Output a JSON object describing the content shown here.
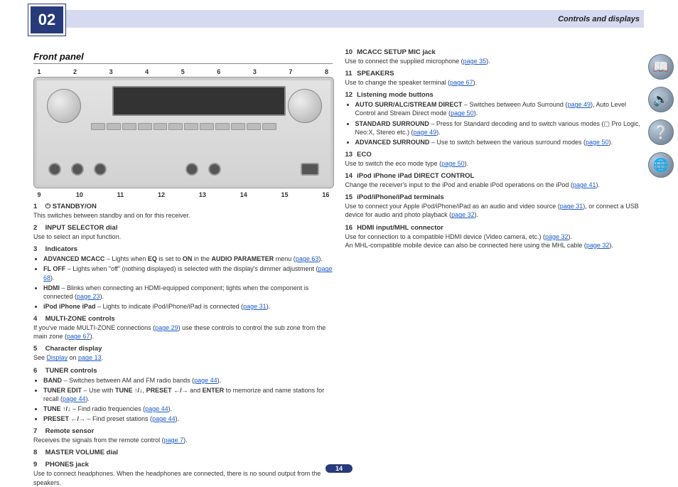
{
  "chapter_number": "02",
  "chapter_title": "Controls and displays",
  "section_title": "Front panel",
  "callouts_top": [
    "1",
    "2",
    "3",
    "4",
    "5",
    "6",
    "3",
    "7",
    "8"
  ],
  "callouts_bot": [
    "9",
    "10",
    "11",
    "12",
    "13",
    "14",
    "15",
    "16"
  ],
  "page_number": "14",
  "left": [
    {
      "n": "1",
      "t": "⏻ STANDBY/ON",
      "b": "This switches between standby and on for this receiver."
    },
    {
      "n": "2",
      "t": "INPUT SELECTOR dial",
      "b": "Use to select an input function."
    },
    {
      "n": "3",
      "t": "Indicators",
      "bullets": [
        "<b>ADVANCED MCACC</b> – Lights when <b>EQ</b> is set to <b>ON</b> in the <b>AUDIO PARAMETER</b> menu (<a class='pl'>page 63</a>).",
        "<b>FL OFF</b> – Lights when \"off\" (nothing displayed) is selected with the display's dimmer adjustment (<a class='pl'>page 68</a>).",
        "<b>HDMI</b> – Blinks when connecting an HDMI-equipped component; lights when the component is connected (<a class='pl'>page 23</a>).",
        "<b>iPod iPhone iPad</b> – Lights to indicate iPod/iPhone/iPad is connected (<a class='pl'>page 31</a>)."
      ]
    },
    {
      "n": "4",
      "t": "MULTI-ZONE controls",
      "b": "If you've made MULTI-ZONE connections (<a class='pl'>page 29</a>) use these controls to control the sub zone from the main zone (<a class='pl'>page 67</a>)."
    },
    {
      "n": "5",
      "t": "Character display",
      "b": "See <a class='pl'>Display</a> on <a class='pl'>page 13</a>."
    },
    {
      "n": "6",
      "t": "TUNER controls",
      "bullets": [
        "<b>BAND</b> – Switches between AM and FM radio bands (<a class='pl'>page 44</a>).",
        "<b>TUNER EDIT</b> – Use with <b>TUNE ↑/↓</b>, <b>PRESET ←/→</b> and <b>ENTER</b> to memorize and name stations for recall (<a class='pl'>page 44</a>).",
        "<b>TUNE ↑/↓</b> – Find radio frequencies (<a class='pl'>page 44</a>).",
        "<b>PRESET ←/→</b> – Find preset stations (<a class='pl'>page 44</a>)."
      ]
    },
    {
      "n": "7",
      "t": "Remote sensor",
      "b": "Receives the signals from the remote control (<a class='pl'>page 7</a>)."
    },
    {
      "n": "8",
      "t": "MASTER VOLUME dial"
    },
    {
      "n": "9",
      "t": "PHONES jack",
      "b": "Use to connect headphones. When the headphones are connected, there is no sound output from the speakers."
    }
  ],
  "right": [
    {
      "n": "10",
      "t": "MCACC SETUP MIC jack",
      "b": "Use to connect the supplied microphone (<a class='pl'>page 35</a>)."
    },
    {
      "n": "11",
      "t": "SPEAKERS",
      "b": "Use to change the speaker terminal (<a class='pl'>page 67</a>)."
    },
    {
      "n": "12",
      "t": "Listening mode buttons",
      "bullets": [
        "<b>AUTO SURR/ALC/STREAM DIRECT</b> – Switches between Auto Surround (<a class='pl'>page 49</a>), Auto Level Control and Stream Direct mode (<a class='pl'>page 50</a>).",
        "<b>STANDARD SURROUND</b> – Press for Standard decoding and to switch various modes (▢ Pro Logic, Neo:X, Stereo etc.) (<a class='pl'>page 49</a>).",
        "<b>ADVANCED SURROUND</b> – Use to switch between the various surround modes (<a class='pl'>page 50</a>)."
      ]
    },
    {
      "n": "13",
      "t": "ECO",
      "b": "Use to switch the eco mode type (<a class='pl'>page 50</a>)."
    },
    {
      "n": "14",
      "t": "iPod iPhone iPad DIRECT CONTROL",
      "b": "Change the receiver's input to the iPod and enable iPod operations on the iPod (<a class='pl'>page 41</a>)."
    },
    {
      "n": "15",
      "t": "iPod/iPhone/iPad terminals",
      "b": "Use to connect your Apple iPod/iPhone/iPad as an audio and video source (<a class='pl'>page 31</a>), or connect a USB device for audio and photo playback (<a class='pl'>page 32</a>)."
    },
    {
      "n": "16",
      "t": "HDMI input/MHL connector",
      "b": "Use for connection to a compatible HDMI device (Video camera, etc.) (<a class='pl'>page 32</a>).<br>An MHL-compatible mobile device can also be connected here using the MHL cable (<a class='pl'>page 32</a>)."
    }
  ]
}
